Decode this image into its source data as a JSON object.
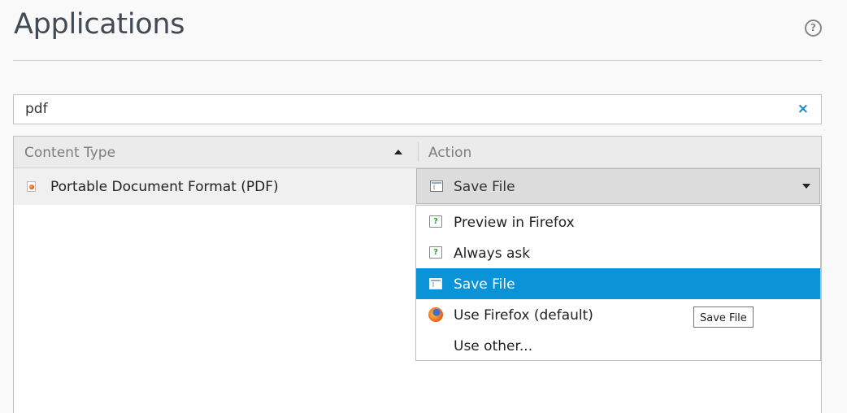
{
  "page": {
    "title": "Applications",
    "help_icon": "help-circle-icon"
  },
  "search": {
    "value": "pdf",
    "clear_glyph": "×"
  },
  "table": {
    "columns": [
      "Content Type",
      "Action"
    ],
    "sort": "ascending",
    "rows": [
      {
        "content_type": "Portable Document Format (PDF)",
        "icon": "pdf-document-icon",
        "action": "Save File"
      }
    ]
  },
  "action_menu": {
    "items": [
      {
        "label": "Preview in Firefox",
        "icon": "preview-chat-icon",
        "selected": false
      },
      {
        "label": "Always ask",
        "icon": "ask-chat-icon",
        "selected": false
      },
      {
        "label": "Save File",
        "icon": "save-file-icon",
        "selected": true
      },
      {
        "label": "Use Firefox (default)",
        "icon": "firefox-icon",
        "selected": false
      },
      {
        "label": "Use other...",
        "icon": "",
        "selected": false
      }
    ]
  },
  "tooltip": {
    "text": "Save File"
  },
  "colors": {
    "selection": "#0a93d6",
    "clear_button": "#1b87c5",
    "header_bg": "#ebebeb"
  }
}
